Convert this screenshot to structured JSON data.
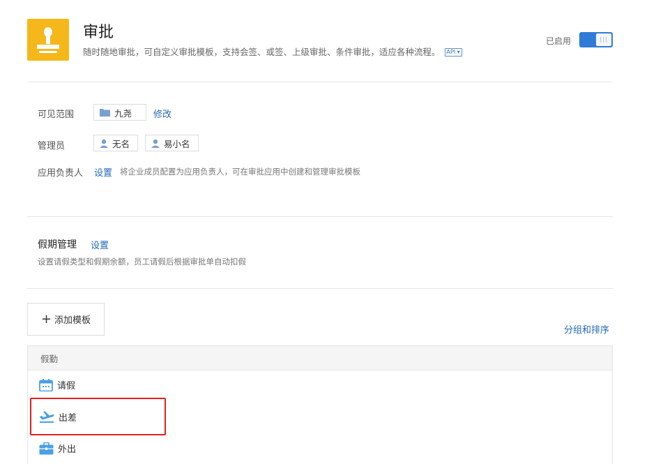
{
  "app": {
    "title": "审批",
    "description": "随时随地审批，可自定义审批模板，支持会签、或签、上级审批、条件审批，适应各种流程。",
    "api_badge": "API ▾",
    "enabled_label": "已启用",
    "icon": "stamp-icon",
    "accent_color": "#f5b71a"
  },
  "settings": {
    "visibility_label": "可见范围",
    "visibility_value": "九尧",
    "visibility_edit": "修改",
    "admin_label": "管理员",
    "admins": [
      "无名",
      "易小名"
    ],
    "owner_label": "应用负责人",
    "owner_action": "设置",
    "owner_hint": "将企业成员配置为应用负责人，可在审批应用中创建和管理审批模板"
  },
  "leave": {
    "title": "假期管理",
    "action": "设置",
    "hint": "设置请假类型和假期余额，员工请假后根据审批单自动扣假"
  },
  "templates": {
    "add_label": "添加模板",
    "sort_label": "分组和排序",
    "group_name": "假勤",
    "items": [
      {
        "label": "请假",
        "icon": "calendar-icon"
      },
      {
        "label": "出差",
        "icon": "airplane-icon"
      },
      {
        "label": "外出",
        "icon": "briefcase-icon"
      }
    ]
  },
  "colors": {
    "link": "#2369b8",
    "toggle_on": "#2f7bd8",
    "template_icon": "#4a9fe6",
    "highlight": "#e02020"
  }
}
